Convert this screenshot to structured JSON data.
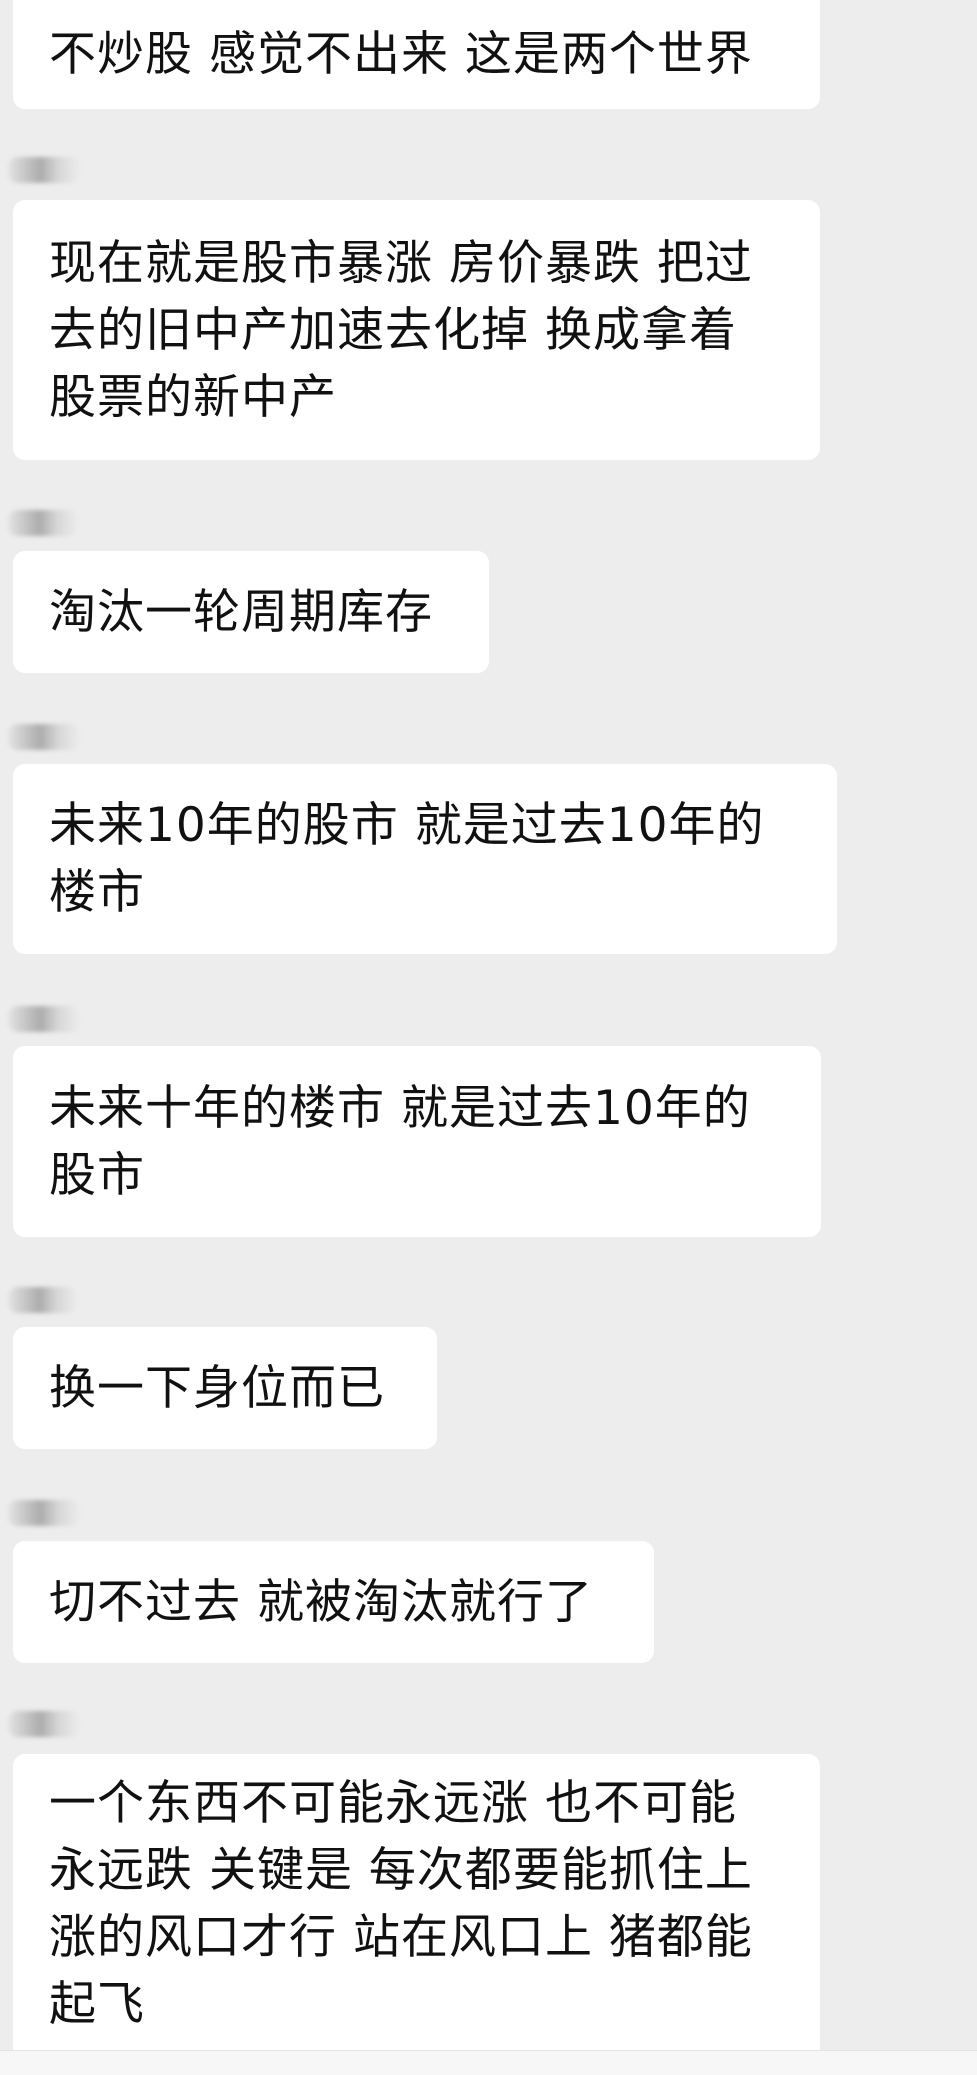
{
  "messages": [
    {
      "text": "不炒股 感觉不出来 这是两个世界",
      "sender": ""
    },
    {
      "text": "现在就是股市暴涨 房价暴跌 把过\n去的旧中产加速去化掉 换成拿着\n股票的新中产",
      "sender": ""
    },
    {
      "text": "淘汰一轮周期库存",
      "sender": ""
    },
    {
      "text": "未来10年的股市 就是过去10年的\n楼市",
      "sender": ""
    },
    {
      "text": "未来十年的楼市 就是过去10年的\n股市",
      "sender": ""
    },
    {
      "text": "换一下身位而已",
      "sender": ""
    },
    {
      "text": "切不过去 就被淘汰就行了",
      "sender": ""
    },
    {
      "text": "一个东西不可能永远涨 也不可能\n永远跌 关键是 每次都要能抓住上\n涨的风口才行 站在风口上 猪都能\n起飞",
      "sender": ""
    }
  ],
  "colors": {
    "background": "#ededed",
    "bubble": "#ffffff",
    "text": "#111111"
  }
}
